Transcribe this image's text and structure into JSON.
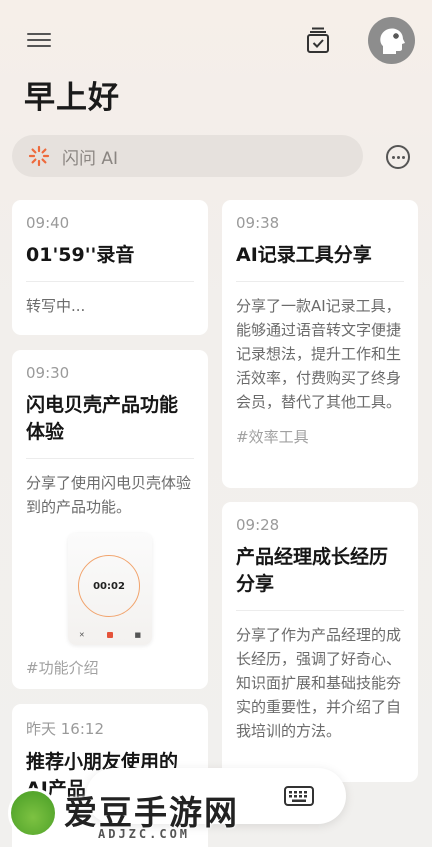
{
  "header": {
    "greeting": "早上好"
  },
  "search": {
    "placeholder": "闪问 AI"
  },
  "left_column": [
    {
      "time": "09:40",
      "title": "01'59''录音",
      "body": "转写中..."
    },
    {
      "time": "09:30",
      "title": "闪电贝壳产品功能体验",
      "body": "分享了使用闪电贝壳体验到的产品功能。",
      "thumb_timer": "00:02",
      "tag": "#功能介绍"
    },
    {
      "time": "昨天 16:12",
      "title": "推荐小朋友使用的AI产品"
    }
  ],
  "right_column": [
    {
      "time": "09:38",
      "title": "AI记录工具分享",
      "body": "分享了一款AI记录工具，能够通过语音转文字便捷记录想法，提升工作和生活效率，付费购买了终身会员，替代了其他工具。",
      "tag": "#效率工具"
    },
    {
      "time": "09:28",
      "title": "产品经理成长经历分享",
      "body": "分享了作为产品经理的成长经历，强调了好奇心、知识面扩展和基础技能夯实的重要性，并介绍了自我培训的方法。"
    }
  ],
  "watermark": {
    "brand": "爱豆手游网",
    "domain": "ADJZC.COM"
  },
  "colors": {
    "accent": "#f08a4b",
    "spinner": "#ee6a3c"
  }
}
